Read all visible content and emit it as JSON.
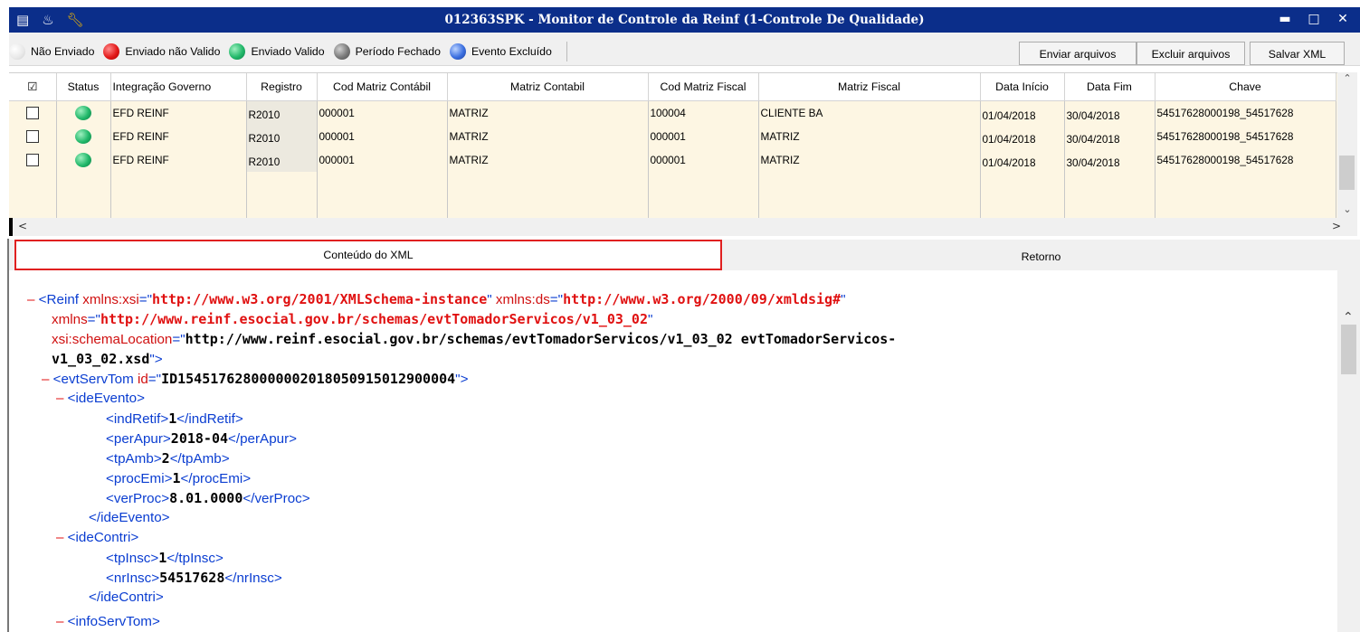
{
  "window": {
    "title": "012363SPK - Monitor de Controle da Reinf (1-Controle De Qualidade)",
    "icons": [
      "list-icon",
      "traffic-light-icon",
      "wrench-icon"
    ],
    "controls": [
      "minimize",
      "maximize",
      "close"
    ]
  },
  "legend": [
    {
      "label": "Não Enviado",
      "color": "#ffffff"
    },
    {
      "label": "Enviado não Valido",
      "color": "#e31a1a"
    },
    {
      "label": "Enviado Valido",
      "color": "#22b86a"
    },
    {
      "label": "Período Fechado",
      "color": "#7a7a7a"
    },
    {
      "label": "Evento Excluído",
      "color": "#3b6fe0"
    }
  ],
  "toolbar": {
    "send_label": "Enviar arquivos",
    "delete_label": "Excluir arquivos",
    "save_label": "Salvar XML"
  },
  "grid": {
    "columns": [
      "☑",
      "Status",
      "Integração Governo",
      "Registro",
      "Cod Matriz Contábil",
      "Matriz Contabil",
      "Cod Matriz Fiscal",
      "Matriz Fiscal",
      "Data Início",
      "Data Fim",
      "Chave"
    ],
    "rows": [
      {
        "checked": false,
        "status": "Enviado Valido",
        "integracao": "EFD REINF",
        "registro": "R2010",
        "cod_contabil": "000001",
        "matriz_contabil": "MATRIZ",
        "cod_fiscal": "100004",
        "matriz_fiscal": "CLIENTE BA",
        "data_inicio": "01/04/2018",
        "data_fim": "30/04/2018",
        "chave": "54517628000198_54517628"
      },
      {
        "checked": false,
        "status": "Enviado Valido",
        "integracao": "EFD REINF",
        "registro": "R2010",
        "cod_contabil": "000001",
        "matriz_contabil": "MATRIZ",
        "cod_fiscal": "000001",
        "matriz_fiscal": "MATRIZ",
        "data_inicio": "01/04/2018",
        "data_fim": "30/04/2018",
        "chave": "54517628000198_54517628"
      },
      {
        "checked": false,
        "status": "Enviado Valido",
        "integracao": "EFD REINF",
        "registro": "R2010",
        "cod_contabil": "000001",
        "matriz_contabil": "MATRIZ",
        "cod_fiscal": "000001",
        "matriz_fiscal": "MATRIZ",
        "data_inicio": "01/04/2018",
        "data_fim": "30/04/2018",
        "chave": "54517628000198_54517628"
      }
    ]
  },
  "tabs": [
    "Conteúdo do XML",
    "Retorno"
  ],
  "xml": {
    "root_tag": "Reinf",
    "attr1_name": "xmlns:xsi",
    "attr1_value": "http://www.w3.org/2001/XMLSchema-instance",
    "attr2_name": "xmlns:ds",
    "attr2_value": "http://www.w3.org/2000/09/xmldsig#",
    "attr3_name": "xmlns",
    "attr3_value": "http://www.reinf.esocial.gov.br/schemas/evtTomadorServicos/v1_03_02",
    "attr4_name": "xsi:schemaLocation",
    "attr4_value_line1": "http://www.reinf.esocial.gov.br/schemas/evtTomadorServicos/v1_03_02 evtTomadorServicos-",
    "attr4_value_line2": "v1_03_02.xsd",
    "evt_tag": "evtServTom",
    "evt_attr": "id",
    "evt_id": "ID1545176280000002018050915012900004",
    "ideEvento": "ideEvento",
    "indRetif": {
      "tag": "indRetif",
      "value": "1"
    },
    "perApur": {
      "tag": "perApur",
      "value": "2018-04"
    },
    "tpAmb": {
      "tag": "tpAmb",
      "value": "2"
    },
    "procEmi": {
      "tag": "procEmi",
      "value": "1"
    },
    "verProc": {
      "tag": "verProc",
      "value": "8.01.0000"
    },
    "ideContri": "ideContri",
    "tpInsc": {
      "tag": "tpInsc",
      "value": "1"
    },
    "nrInsc": {
      "tag": "nrInsc",
      "value": "54517628"
    },
    "infoServTom": "infoServTom"
  }
}
